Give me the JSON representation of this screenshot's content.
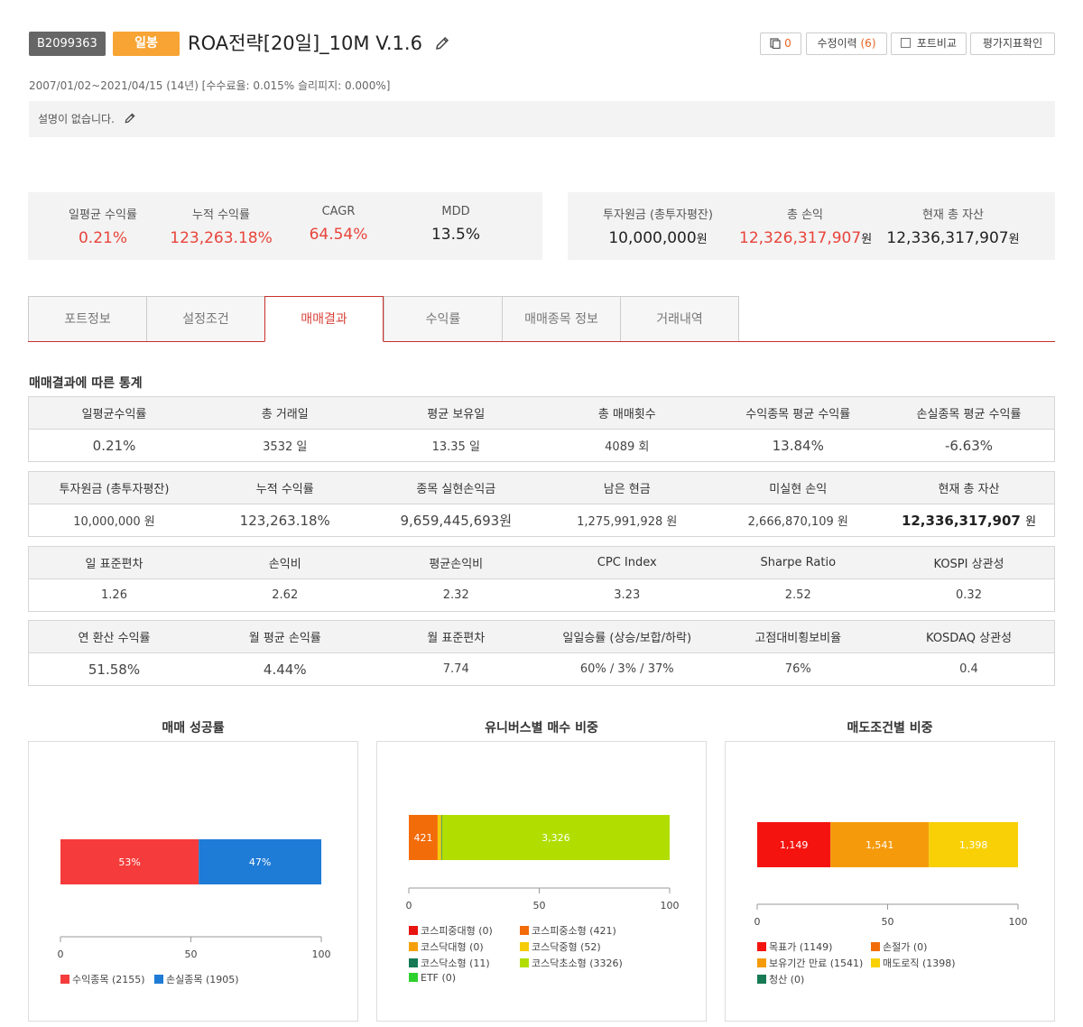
{
  "header": {
    "id_badge": "B2099363",
    "type_badge": "일봉",
    "title": "ROA전략[20일]_10M V.1.6",
    "buttons": {
      "copy_count": "0",
      "history_label": "수정이력",
      "history_count": "(6)",
      "compare_label": "포트비교",
      "eval_label": "평가지표확인"
    },
    "period": "2007/01/02~2021/04/15 (14년) [수수료율: 0.015% 슬리피지: 0.000%]",
    "description": "설명이 없습니다."
  },
  "summary_left": [
    {
      "label": "일평균 수익률",
      "value": "0.21%"
    },
    {
      "label": "누적 수익률",
      "value": "123,263.18%"
    },
    {
      "label": "CAGR",
      "value": "64.54%"
    },
    {
      "label": "MDD",
      "value": "13.5%"
    }
  ],
  "summary_right": [
    {
      "label": "투자원금 (총투자평잔)",
      "value": "10,000,000",
      "unit": "원"
    },
    {
      "label": "총 손익",
      "value": "12,326,317,907",
      "unit": "원"
    },
    {
      "label": "현재 총 자산",
      "value": "12,336,317,907",
      "unit": "원"
    }
  ],
  "tabs": [
    "포트정보",
    "설정조건",
    "매매결과",
    "수익률",
    "매매종목 정보",
    "거래내역"
  ],
  "active_tab": "매매결과",
  "stats_title": "매매결과에 따른 통계",
  "stats": {
    "t1": {
      "h": [
        "일평균수익률",
        "총 거래일",
        "평균 보유일",
        "총 매매횟수",
        "수익종목 평균 수익률",
        "손실종목 평균 수익률"
      ],
      "v": [
        "0.21%",
        "3532 일",
        "13.35 일",
        "4089 회",
        "13.84%",
        "-6.63%"
      ]
    },
    "t2": {
      "h": [
        "투자원금 (총투자평잔)",
        "누적 수익률",
        "종목 실현손익금",
        "남은 현금",
        "미실현 손익",
        "현재 총 자산"
      ],
      "v": [
        "10,000,000 원",
        "123,263.18%",
        "9,659,445,693원",
        "1,275,991,928 원",
        "2,666,870,109 원",
        "12,336,317,907"
      ],
      "last_unit": "원"
    },
    "t3": {
      "h": [
        "일 표준편차",
        "손익비",
        "평균손익비",
        "CPC Index",
        "Sharpe Ratio",
        "KOSPI 상관성"
      ],
      "v": [
        "1.26",
        "2.62",
        "2.32",
        "3.23",
        "2.52",
        "0.32"
      ]
    },
    "t4": {
      "h": [
        "연 환산 수익률",
        "월 평균 손익률",
        "월 표준편차",
        "일일승률 (상승/보합/하락)",
        "고점대비횡보비율",
        "KOSDAQ 상관성"
      ],
      "v": [
        "51.58%",
        "4.44%",
        "7.74",
        "60% / 3% / 37%",
        "76%",
        "0.4"
      ]
    }
  },
  "colors": {
    "accent": "#e8443b",
    "blue": "#2c7ae0",
    "badge_orange": "#f7a434"
  },
  "chart_data": [
    {
      "type": "bar",
      "orientation": "horizontal-stacked",
      "title": "매매 성공률",
      "xlim": [
        0,
        100
      ],
      "xticks": [
        "0",
        "50",
        "100"
      ],
      "series": [
        {
          "name": "수익종목 (2155)",
          "value": 53,
          "label": "53%",
          "color": "#f53b3b"
        },
        {
          "name": "손실종목 (1905)",
          "value": 47,
          "label": "47%",
          "color": "#1e7bd6"
        }
      ]
    },
    {
      "type": "bar",
      "orientation": "horizontal-stacked",
      "title": "유니버스별 매수 비중",
      "xlim": [
        0,
        100
      ],
      "xticks": [
        "0",
        "50",
        "100"
      ],
      "series": [
        {
          "name": "코스피중대형 (0)",
          "count": 0,
          "label": "",
          "color": "#e8150f"
        },
        {
          "name": "코스피중소형 (421)",
          "count": 421,
          "label": "421",
          "color": "#f26c0a"
        },
        {
          "name": "코스닥대형 (0)",
          "count": 0,
          "label": "",
          "color": "#f5a00a"
        },
        {
          "name": "코스닥중형 (52)",
          "count": 52,
          "label": "",
          "color": "#f5cc0a"
        },
        {
          "name": "코스닥소형 (11)",
          "count": 11,
          "label": "",
          "color": "#167a55"
        },
        {
          "name": "코스닥초소형 (3326)",
          "count": 3326,
          "label": "3,326",
          "color": "#b1de00"
        },
        {
          "name": "ETF (0)",
          "count": 0,
          "label": "",
          "color": "#2dd12d"
        }
      ]
    },
    {
      "type": "bar",
      "orientation": "horizontal-stacked",
      "title": "매도조건별 비중",
      "xlim": [
        0,
        100
      ],
      "xticks": [
        "0",
        "50",
        "100"
      ],
      "series": [
        {
          "name": "목표가 (1149)",
          "count": 1149,
          "label": "1,149",
          "color": "#f5130f"
        },
        {
          "name": "손절가 (0)",
          "count": 0,
          "label": "",
          "color": "#f26c0a"
        },
        {
          "name": "보유기간 만료 (1541)",
          "count": 1541,
          "label": "1,541",
          "color": "#f59a0a"
        },
        {
          "name": "매도로직 (1398)",
          "count": 1398,
          "label": "1,398",
          "color": "#f8d005"
        },
        {
          "name": "청산 (0)",
          "count": 0,
          "label": "",
          "color": "#167a55"
        }
      ]
    }
  ]
}
